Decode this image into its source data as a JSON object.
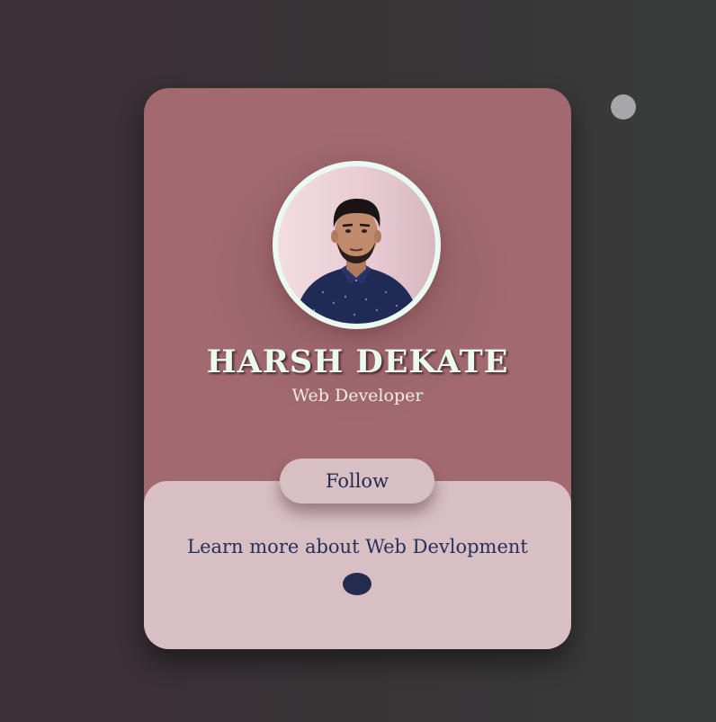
{
  "theme": {
    "accent": "#a26a70",
    "card_bottom": "#d8bfc3",
    "text_dark": "#232b4f",
    "name_color": "#eafaee"
  },
  "profile": {
    "name": "HARSH DEKATE",
    "role": "Web Developer",
    "avatar_icon": "profile-photo"
  },
  "actions": {
    "follow_label": "Follow"
  },
  "footer": {
    "learn_more": "Learn more about Web Devlopment"
  }
}
